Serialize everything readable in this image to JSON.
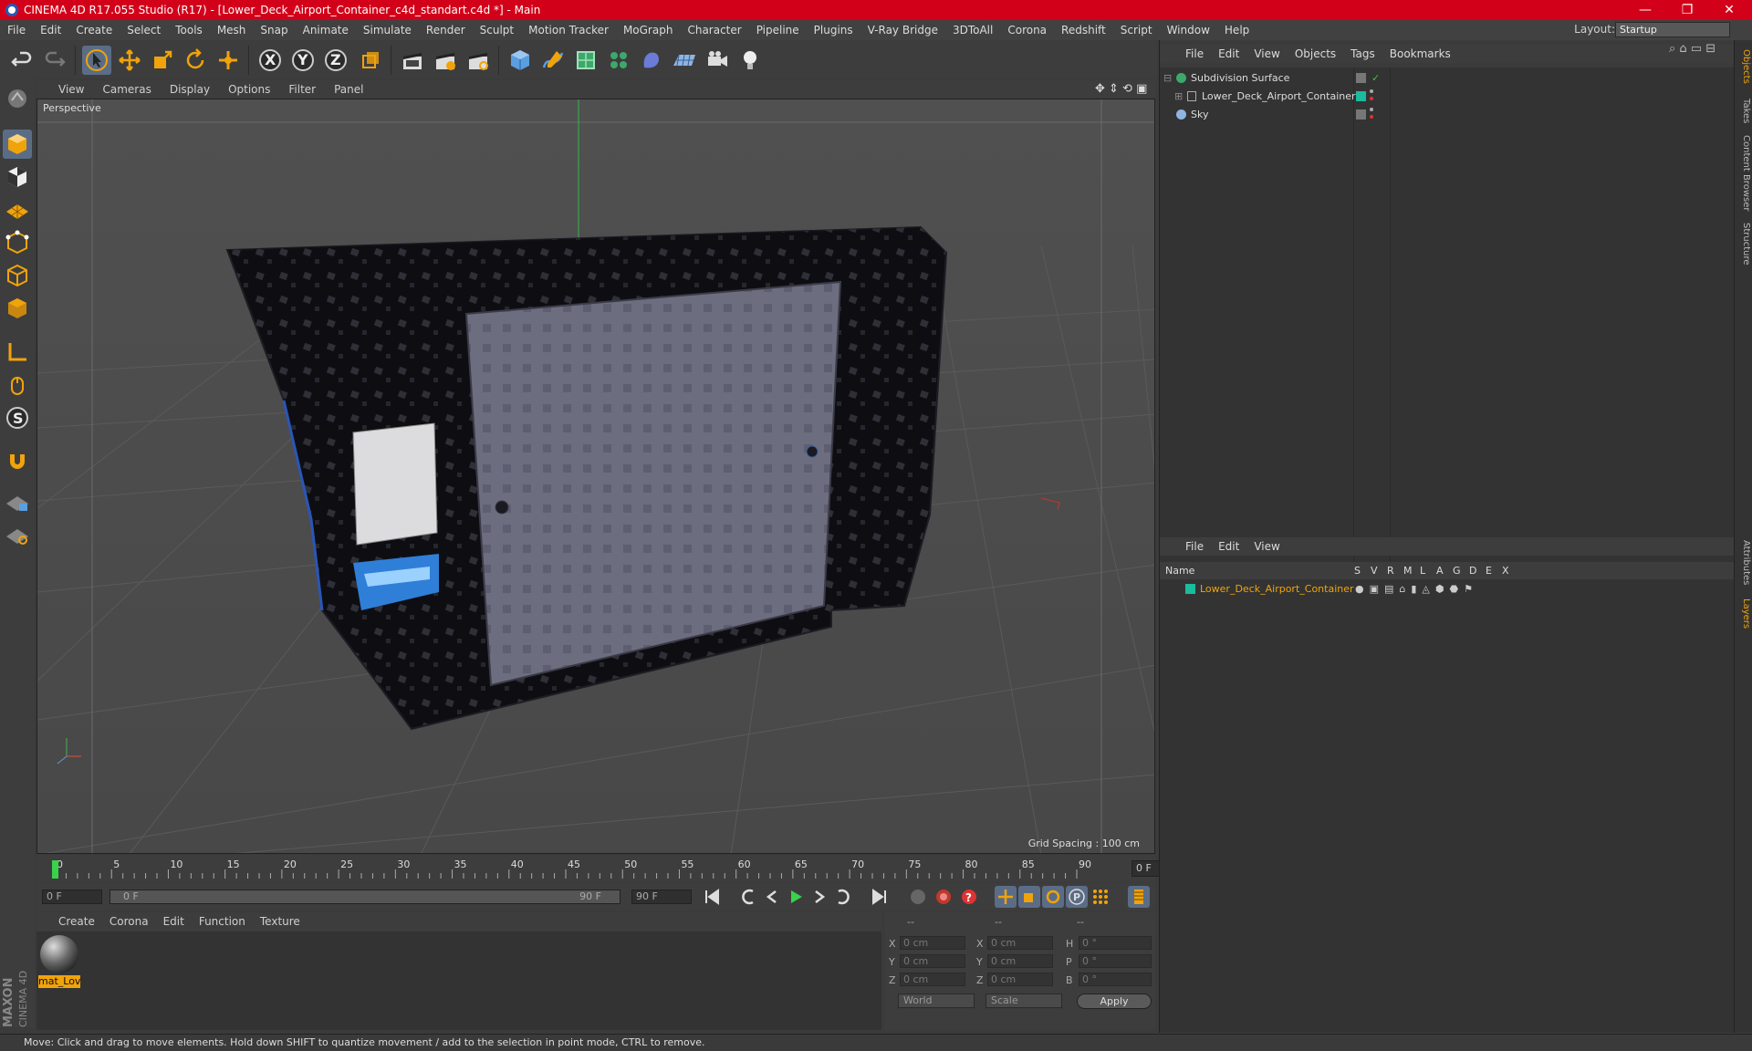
{
  "window": {
    "title": "CINEMA 4D R17.055 Studio (R17) - [Lower_Deck_Airport_Container_c4d_standart.c4d *] - Main",
    "minimize": "—",
    "maximize": "❐",
    "close": "✕"
  },
  "menu": [
    "File",
    "Edit",
    "Create",
    "Select",
    "Tools",
    "Mesh",
    "Snap",
    "Animate",
    "Simulate",
    "Render",
    "Sculpt",
    "Motion Tracker",
    "MoGraph",
    "Character",
    "Pipeline",
    "Plugins",
    "V-Ray Bridge",
    "3DToAll",
    "Corona",
    "Redshift",
    "Script",
    "Window",
    "Help"
  ],
  "layout": {
    "label": "Layout:",
    "value": "Startup"
  },
  "toolbar": {
    "x_axis": "X",
    "y_axis": "Y",
    "z_axis": "Z"
  },
  "viewport": {
    "menu": [
      "View",
      "Cameras",
      "Display",
      "Options",
      "Filter",
      "Panel"
    ],
    "label": "Perspective",
    "grid_spacing": "Grid Spacing : 100 cm"
  },
  "timeline": {
    "ticks": [
      "0",
      "5",
      "10",
      "15",
      "20",
      "25",
      "30",
      "35",
      "40",
      "45",
      "50",
      "55",
      "60",
      "65",
      "70",
      "75",
      "80",
      "85",
      "90"
    ],
    "frame_end": "0 F",
    "current": "0 F",
    "range_start": "0 F",
    "range_end": "90 F",
    "max": "90 F",
    "playhead": 0
  },
  "materials": {
    "menu": [
      "Create",
      "Corona",
      "Edit",
      "Function",
      "Texture"
    ],
    "item": "mat_Lov"
  },
  "coords": {
    "head1": "--",
    "head2": "--",
    "head3": "--",
    "rows": [
      {
        "a": "X",
        "av": "0 cm",
        "b": "X",
        "bv": "0 cm",
        "c": "H",
        "cv": "0 °"
      },
      {
        "a": "Y",
        "av": "0 cm",
        "b": "Y",
        "bv": "0 cm",
        "c": "P",
        "cv": "0 °"
      },
      {
        "a": "Z",
        "av": "0 cm",
        "b": "Z",
        "bv": "0 cm",
        "c": "B",
        "cv": "0 °"
      }
    ],
    "world": "World",
    "scale": "Scale",
    "apply": "Apply"
  },
  "objects": {
    "menu": [
      "File",
      "Edit",
      "View",
      "Objects",
      "Tags",
      "Bookmarks"
    ],
    "items": [
      {
        "name": "Subdivision Surface"
      },
      {
        "name": "Lower_Deck_Airport_Container"
      },
      {
        "name": "Sky"
      }
    ]
  },
  "layers": {
    "menu": [
      "File",
      "Edit",
      "View"
    ],
    "cols": [
      "Name",
      "S",
      "V",
      "R",
      "M",
      "L",
      "A",
      "G",
      "D",
      "E",
      "X"
    ],
    "item": "Lower_Deck_Airport_Container"
  },
  "sidetabs": [
    "Objects",
    "Takes",
    "Content Browser",
    "Structure",
    "Attributes",
    "Layers"
  ],
  "brand": {
    "maxon": "MAXON",
    "c4d": "CINEMA 4D"
  },
  "status": "Move: Click and drag to move elements. Hold down SHIFT to quantize movement / add to the selection in point mode, CTRL to remove.",
  "colors": {
    "title_bar": "#d3001a",
    "accent": "#f0a30a",
    "layer_green": "#1abc9c"
  }
}
